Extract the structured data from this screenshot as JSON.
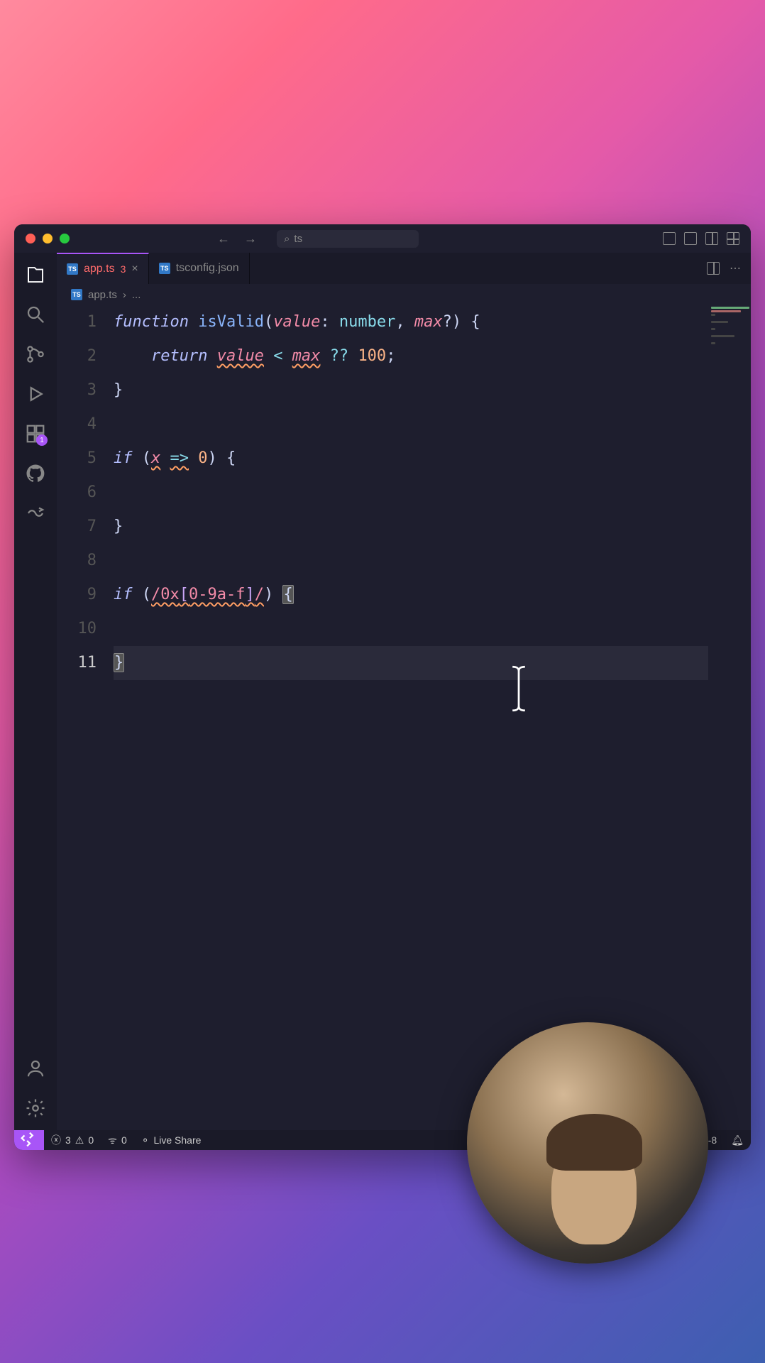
{
  "search": {
    "placeholder": "ts"
  },
  "tabs": [
    {
      "label": "app.ts",
      "errors": "3",
      "active": true
    },
    {
      "label": "tsconfig.json",
      "active": false
    }
  ],
  "breadcrumb": {
    "file": "app.ts",
    "symbol": "..."
  },
  "activitybar": {
    "extensions_badge": "1"
  },
  "code": {
    "lines": [
      {
        "n": "1",
        "tokens": [
          [
            "kw",
            "function "
          ],
          [
            "fn",
            "isValid"
          ],
          [
            "punc",
            "("
          ],
          [
            "param",
            "value"
          ],
          [
            "punc",
            ": "
          ],
          [
            "type",
            "number"
          ],
          [
            "punc",
            ", "
          ],
          [
            "param",
            "max"
          ],
          [
            "punc",
            "?"
          ],
          [
            "punc",
            ") {"
          ]
        ]
      },
      {
        "n": "2",
        "tokens": [
          [
            "punc",
            "    "
          ],
          [
            "kw",
            "return "
          ],
          [
            "param squiggle",
            "value"
          ],
          [
            "punc",
            " "
          ],
          [
            "op",
            "<"
          ],
          [
            "punc",
            " "
          ],
          [
            "param squiggle",
            "max"
          ],
          [
            "punc",
            " "
          ],
          [
            "op",
            "??"
          ],
          [
            "punc",
            " "
          ],
          [
            "num",
            "100"
          ],
          [
            "punc",
            ";"
          ]
        ]
      },
      {
        "n": "3",
        "tokens": [
          [
            "punc",
            "}"
          ]
        ]
      },
      {
        "n": "4",
        "tokens": []
      },
      {
        "n": "5",
        "tokens": [
          [
            "kw",
            "if "
          ],
          [
            "punc",
            "("
          ],
          [
            "param squiggle",
            "x"
          ],
          [
            "punc",
            " "
          ],
          [
            "op squiggle",
            "=>"
          ],
          [
            "punc",
            " "
          ],
          [
            "num",
            "0"
          ],
          [
            "punc",
            ") {"
          ]
        ]
      },
      {
        "n": "6",
        "tokens": []
      },
      {
        "n": "7",
        "tokens": [
          [
            "punc",
            "}"
          ]
        ]
      },
      {
        "n": "8",
        "tokens": []
      },
      {
        "n": "9",
        "tokens": [
          [
            "kw",
            "if "
          ],
          [
            "punc",
            "("
          ],
          [
            "regex squiggle",
            "/0x"
          ],
          [
            "regex-bracket squiggle",
            "["
          ],
          [
            "regex squiggle",
            "0-9a-f"
          ],
          [
            "regex-bracket squiggle",
            "]"
          ],
          [
            "regex squiggle",
            "/"
          ],
          [
            "punc",
            ") "
          ],
          [
            "punc brace-match",
            "{"
          ]
        ]
      },
      {
        "n": "10",
        "tokens": []
      },
      {
        "n": "11",
        "current": true,
        "tokens": [
          [
            "punc brace-match",
            "}"
          ]
        ]
      }
    ]
  },
  "statusbar": {
    "errors": "3",
    "warnings": "0",
    "ports": "0",
    "liveshare": "Live Share",
    "encoding": "UTF-8"
  }
}
